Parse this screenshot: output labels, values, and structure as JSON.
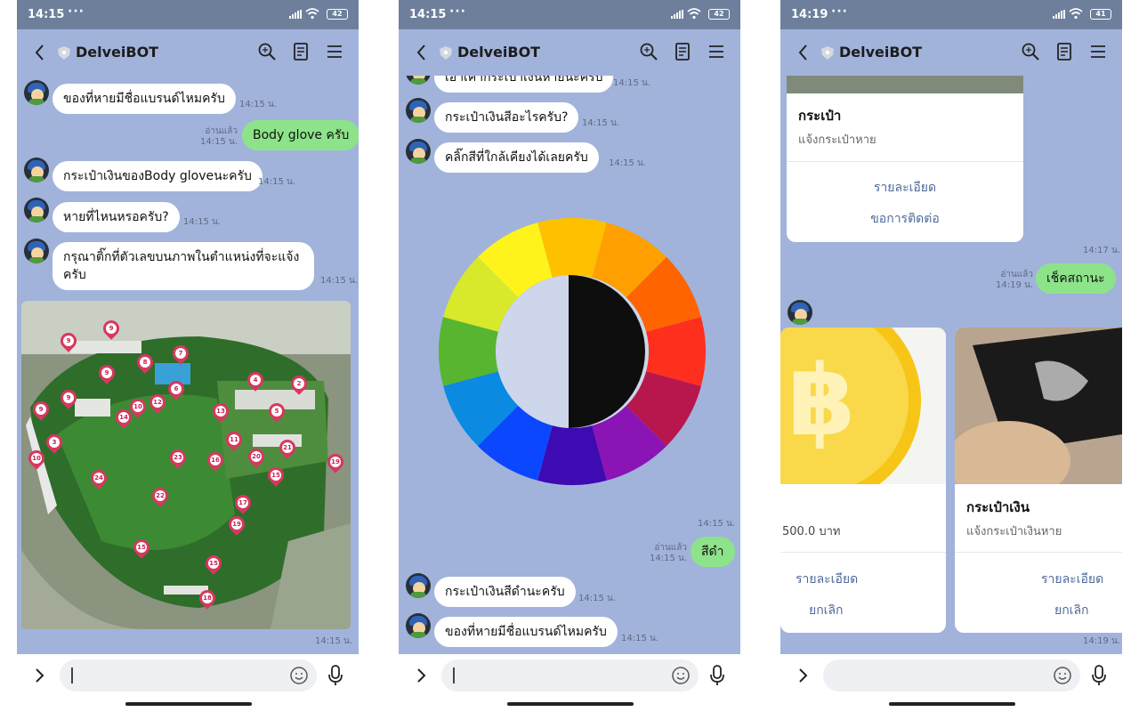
{
  "colors": {
    "chat_bg": "#a1b3db",
    "status_bar": "#6d7f9b",
    "my_bubble": "#8de389",
    "link": "#4f6a9a",
    "pin": "#d8375f"
  },
  "icons": [
    "back-icon",
    "shield-icon",
    "search-icon",
    "note-icon",
    "menu-icon",
    "chevron-right-icon",
    "emoji-icon",
    "mic-icon"
  ],
  "screens": [
    {
      "status": {
        "time": "14:15",
        "dots": "···",
        "battery": "42"
      },
      "header": {
        "title": "DelveiBOT"
      },
      "messages": [
        {
          "text": "ของที่หายมีชื่อแบรนด์ไหมครับ",
          "time": "14:15 น."
        },
        {
          "text": "Body glove ครับ",
          "read": "อ่านแล้ว",
          "time": "14:15 น."
        },
        {
          "text": "กระเป๋าเงินของBody gloveนะครับ",
          "time": "14:15 น."
        },
        {
          "text": "หายที่ไหนหรอครับ?",
          "time": "14:15 น."
        },
        {
          "text": "กรุณาติ๊กที่ตัวเลขบนภาพในตำแหน่งที่จะแจ้งครับ",
          "time": "14:15 น."
        }
      ],
      "map_time": "14:15 น.",
      "map_pins": [
        "9",
        "9",
        "9",
        "8",
        "7",
        "9",
        "4",
        "2",
        "6",
        "9",
        "10",
        "12",
        "14",
        "13",
        "5",
        "3",
        "10",
        "11",
        "21",
        "23",
        "16",
        "20",
        "19",
        "24",
        "15",
        "22",
        "17",
        "19",
        "15",
        "15",
        "18",
        "15"
      ]
    },
    {
      "status": {
        "time": "14:15",
        "dots": "···",
        "battery": "42"
      },
      "header": {
        "title": "DelveiBOT"
      },
      "messages": [
        {
          "text": "เอาเค้ากระเป๋าเงินหายนะครับ",
          "time": "14:15 น."
        },
        {
          "text": "กระเป๋าเงินสีอะไรครับ?",
          "time": "14:15 น."
        },
        {
          "text": "คลิ๊กสีที่ใกล้เคียงได้เลยครับ",
          "time": "14:15 น."
        },
        {
          "text": "สีดำ",
          "read": "อ่านแล้ว",
          "time": "14:15 น."
        },
        {
          "text": "กระเป๋าเงินสีดำนะครับ",
          "time": "14:15 น."
        },
        {
          "text": "ของที่หายมีชื่อแบรนด์ไหมครับ",
          "time": "14:15 น."
        }
      ],
      "wheel_time": "14:15 น.",
      "wheel_colors": [
        "#ffc000",
        "#ff9f00",
        "#ff6400",
        "#ff2f1e",
        "#b8174e",
        "#8b14b5",
        "#3e0ab2",
        "#0a47ff",
        "#0a8ae0",
        "#58b52f",
        "#d8e82a",
        "#fff31c"
      ]
    },
    {
      "status": {
        "time": "14:19",
        "dots": "···",
        "battery": "41"
      },
      "header": {
        "title": "DelveiBOT"
      },
      "card_top": {
        "title": "กระเป๋า",
        "subtitle": "แจ้งกระเป๋าหาย",
        "details": "รายละเอียด",
        "contact": "ขอการติดต่อ",
        "time": "14:17 น."
      },
      "my_message": {
        "text": "เช็คสถานะ",
        "read": "อ่านแล้ว",
        "time": "14:19 น."
      },
      "card_left": {
        "price": "500.0 บาท",
        "details": "รายละเอียด",
        "cancel": "ยกเลิก"
      },
      "card_right": {
        "title": "กระเป๋าเงิน",
        "subtitle": "แจ้งกระเป๋าเงินหาย",
        "details": "รายละเอียด",
        "cancel": "ยกเลิก"
      },
      "bottom_time": "14:19 น."
    }
  ]
}
